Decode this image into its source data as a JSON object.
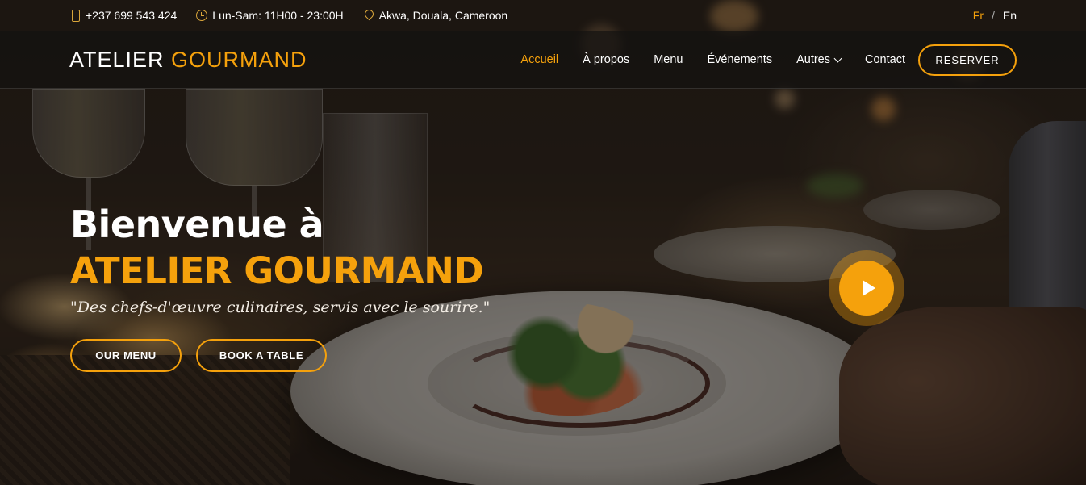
{
  "colors": {
    "accent": "#f5a10c",
    "text": "#ffffff",
    "header_bg": "#141210"
  },
  "topbar": {
    "phone": "+237 699 543 424",
    "phone_icon": "phone-icon",
    "hours": "Lun-Sam: 11H00 - 23:00H",
    "hours_icon": "clock-icon",
    "address": "Akwa, Douala, Cameroon",
    "address_icon": "map-pin-icon",
    "lang_fr": "Fr",
    "lang_sep": "/",
    "lang_en": "En"
  },
  "header": {
    "logo_main": "ATELIER",
    "logo_accent": "GOURMAND",
    "nav": {
      "home": "Accueil",
      "about": "À propos",
      "menu": "Menu",
      "events": "Événements",
      "more": "Autres",
      "contact": "Contact"
    },
    "active_nav": "Accueil",
    "reserve_label": "RESERVER"
  },
  "hero": {
    "title_line1": "Bienvenue à",
    "title_line2": "ATELIER GOURMAND",
    "subtitle": "\"Des chefs-d'œuvre culinaires, servis avec le sourire.\"",
    "btn_menu": "OUR MENU",
    "btn_table": "BOOK A TABLE",
    "play_icon": "play-icon"
  }
}
